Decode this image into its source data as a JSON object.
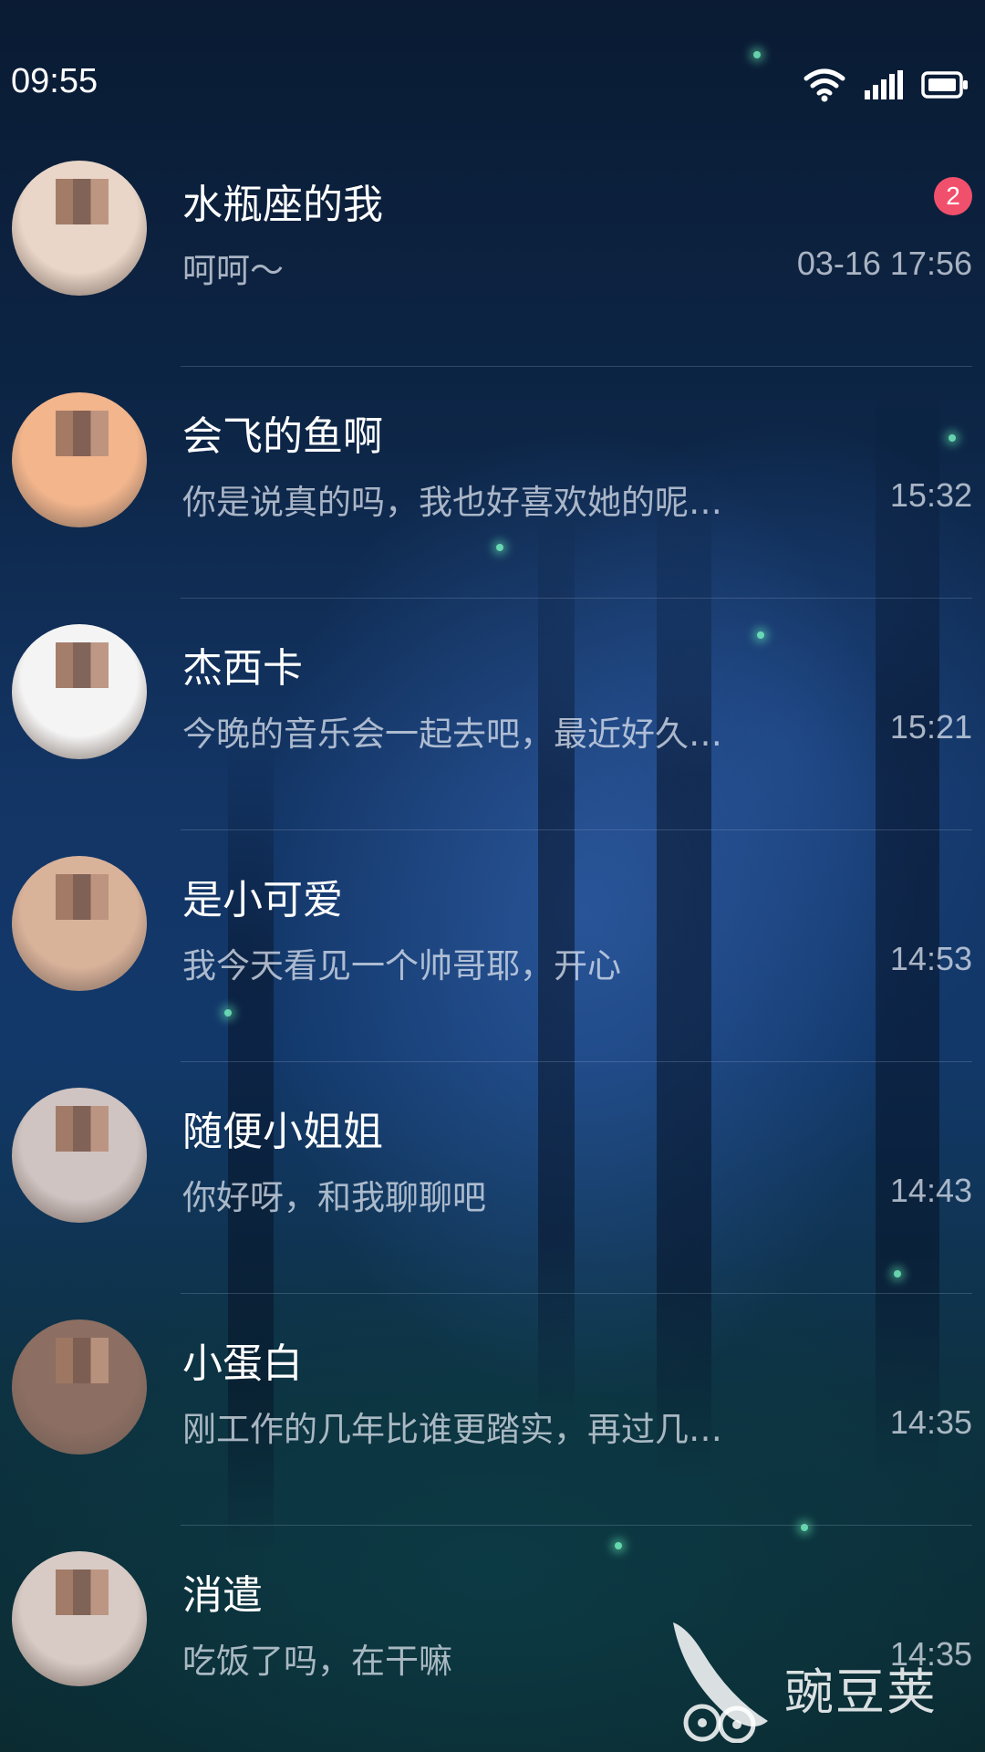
{
  "status_bar": {
    "time": "09:55",
    "wifi_icon": "wifi-icon",
    "signal_icon": "cellular-signal-icon",
    "battery_icon": "battery-icon"
  },
  "chats": [
    {
      "name": "水瓶座的我",
      "preview": "呵呵～",
      "time": "03-16 17:56",
      "unread": "2",
      "avatar_color": "#e9d6c8"
    },
    {
      "name": "会飞的鱼啊",
      "preview": "你是说真的吗，我也好喜欢她的呢…",
      "time": "15:32",
      "avatar_color": "#f2b58c"
    },
    {
      "name": "杰西卡",
      "preview": "今晚的音乐会一起去吧，最近好久…",
      "time": "15:21",
      "avatar_color": "#f4f4f4"
    },
    {
      "name": "是小可爱",
      "preview": "我今天看见一个帅哥耶，开心",
      "time": "14:53",
      "avatar_color": "#d9b29a"
    },
    {
      "name": "随便小姐姐",
      "preview": "你好呀，和我聊聊吧",
      "time": "14:43",
      "avatar_color": "#cfc4c2"
    },
    {
      "name": "小蛋白",
      "preview": "刚工作的几年比谁更踏实，再过几…",
      "time": "14:35",
      "avatar_color": "#8c6e62"
    },
    {
      "name": "消遣",
      "preview": "吃饭了吗，在干嘛",
      "time": "14:35",
      "avatar_color": "#d8cbc6"
    }
  ],
  "watermark": {
    "text": "豌豆荚",
    "logo_icon": "pea-pod-logo-icon"
  }
}
